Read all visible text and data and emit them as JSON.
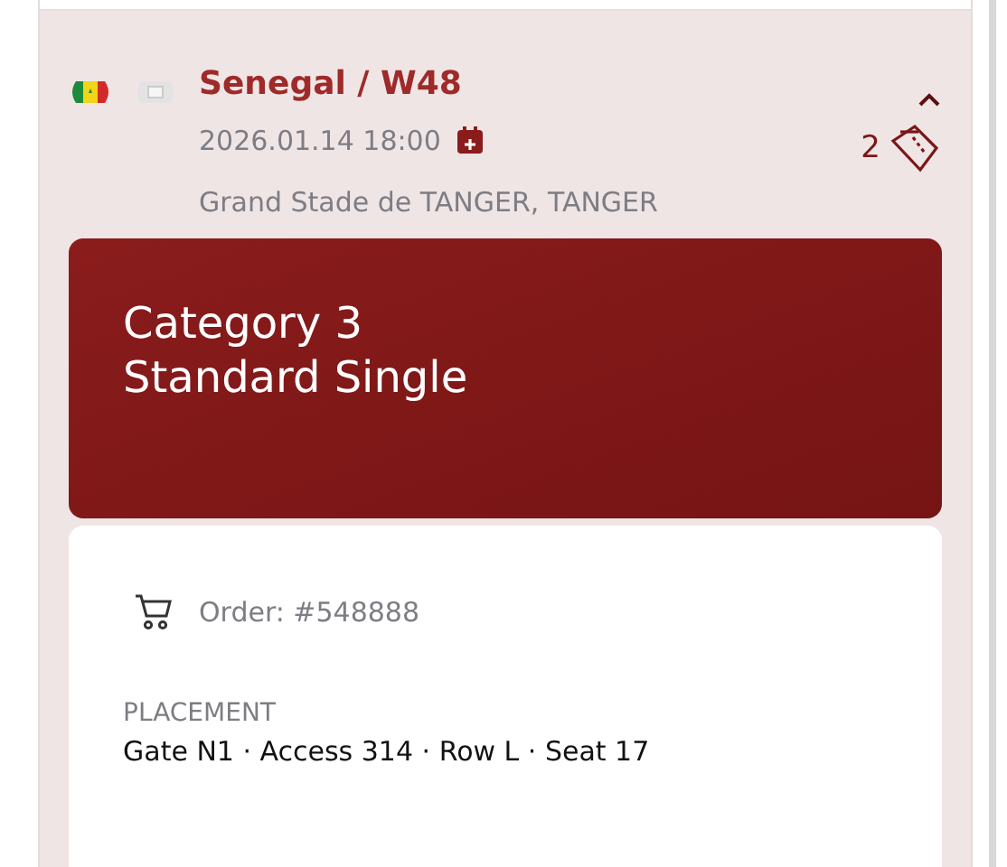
{
  "match": {
    "title": "Senegal / W48",
    "datetime": "2026.01.14 18:00",
    "venue": "Grand Stade de TANGER, TANGER",
    "expanded": true,
    "ticket_count": "2"
  },
  "ticket": {
    "category": "Category 3",
    "type": "Standard Single",
    "order": "Order: #548888",
    "placement_label": "PLACEMENT",
    "placement": "Gate N1 · Access 314 · Row L · Seat 17"
  }
}
